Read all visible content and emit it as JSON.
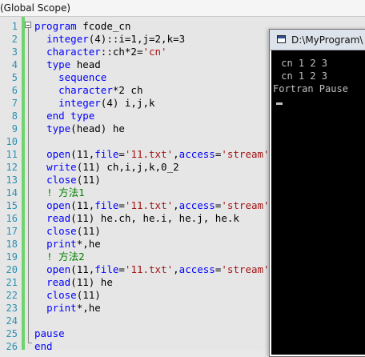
{
  "scope_bar": {
    "label": "(Global Scope)"
  },
  "editor": {
    "line_numbers": [
      "1",
      "2",
      "3",
      "4",
      "5",
      "6",
      "7",
      "8",
      "9",
      "10",
      "11",
      "12",
      "13",
      "14",
      "15",
      "16",
      "17",
      "18",
      "19",
      "20",
      "21",
      "22",
      "23",
      "24",
      "25",
      "26"
    ],
    "lines": [
      [
        {
          "t": "program",
          "k": "k"
        },
        {
          "t": " fcode_cn"
        }
      ],
      [
        {
          "t": "  "
        },
        {
          "t": "integer",
          "k": "k"
        },
        {
          "t": "(4)::i=1,j=2,k=3"
        }
      ],
      [
        {
          "t": "  "
        },
        {
          "t": "character",
          "k": "k"
        },
        {
          "t": "::ch*2="
        },
        {
          "t": "'cn'",
          "k": "s"
        }
      ],
      [
        {
          "t": "  "
        },
        {
          "t": "type",
          "k": "k"
        },
        {
          "t": " head"
        }
      ],
      [
        {
          "t": "    "
        },
        {
          "t": "sequence",
          "k": "k"
        }
      ],
      [
        {
          "t": "    "
        },
        {
          "t": "character",
          "k": "k"
        },
        {
          "t": "*2 ch"
        }
      ],
      [
        {
          "t": "    "
        },
        {
          "t": "integer",
          "k": "k"
        },
        {
          "t": "(4) i,j,k"
        }
      ],
      [
        {
          "t": "  "
        },
        {
          "t": "end type",
          "k": "k"
        }
      ],
      [
        {
          "t": "  "
        },
        {
          "t": "type",
          "k": "k"
        },
        {
          "t": "(head) he"
        }
      ],
      [
        {
          "t": ""
        }
      ],
      [
        {
          "t": "  "
        },
        {
          "t": "open",
          "k": "k"
        },
        {
          "t": "(11,"
        },
        {
          "t": "file",
          "k": "k"
        },
        {
          "t": "="
        },
        {
          "t": "'11.txt'",
          "k": "s"
        },
        {
          "t": ","
        },
        {
          "t": "access",
          "k": "k"
        },
        {
          "t": "="
        },
        {
          "t": "'stream'",
          "k": "s"
        },
        {
          "t": ")"
        }
      ],
      [
        {
          "t": "  "
        },
        {
          "t": "write",
          "k": "k"
        },
        {
          "t": "(11) ch,i,j,k,0_2"
        }
      ],
      [
        {
          "t": "  "
        },
        {
          "t": "close",
          "k": "k"
        },
        {
          "t": "(11)"
        }
      ],
      [
        {
          "t": "  "
        },
        {
          "t": "! 方法1",
          "k": "c"
        }
      ],
      [
        {
          "t": "  "
        },
        {
          "t": "open",
          "k": "k"
        },
        {
          "t": "(11,"
        },
        {
          "t": "file",
          "k": "k"
        },
        {
          "t": "="
        },
        {
          "t": "'11.txt'",
          "k": "s"
        },
        {
          "t": ","
        },
        {
          "t": "access",
          "k": "k"
        },
        {
          "t": "="
        },
        {
          "t": "'stream'",
          "k": "s"
        },
        {
          "t": ")"
        }
      ],
      [
        {
          "t": "  "
        },
        {
          "t": "read",
          "k": "k"
        },
        {
          "t": "(11) he.ch, he.i, he.j, he.k"
        }
      ],
      [
        {
          "t": "  "
        },
        {
          "t": "close",
          "k": "k"
        },
        {
          "t": "(11)"
        }
      ],
      [
        {
          "t": "  "
        },
        {
          "t": "print",
          "k": "k"
        },
        {
          "t": "*,he"
        }
      ],
      [
        {
          "t": "  "
        },
        {
          "t": "! 方法2",
          "k": "c"
        }
      ],
      [
        {
          "t": "  "
        },
        {
          "t": "open",
          "k": "k"
        },
        {
          "t": "(11,"
        },
        {
          "t": "file",
          "k": "k"
        },
        {
          "t": "="
        },
        {
          "t": "'11.txt'",
          "k": "s"
        },
        {
          "t": ","
        },
        {
          "t": "access",
          "k": "k"
        },
        {
          "t": "="
        },
        {
          "t": "'stream'",
          "k": "s"
        },
        {
          "t": ")"
        }
      ],
      [
        {
          "t": "  "
        },
        {
          "t": "read",
          "k": "k"
        },
        {
          "t": "(11) he"
        }
      ],
      [
        {
          "t": "  "
        },
        {
          "t": "close",
          "k": "k"
        },
        {
          "t": "(11)"
        }
      ],
      [
        {
          "t": "  "
        },
        {
          "t": "print",
          "k": "k"
        },
        {
          "t": "*,he"
        }
      ],
      [
        {
          "t": ""
        }
      ],
      [
        {
          "t": "pause",
          "k": "k"
        }
      ],
      [
        {
          "t": "end",
          "k": "k"
        }
      ]
    ]
  },
  "console": {
    "title": "D:\\MyProgram\\",
    "output": [
      " cn 1 2 3",
      " cn 1 2 3",
      "Fortran Pause"
    ]
  },
  "colors": {
    "keyword": "#0000ff",
    "string": "#a31515",
    "comment": "#008000",
    "line_number": "#2b91af",
    "change_bar": "#6fd46f",
    "console_bg": "#000000",
    "console_text": "#c0c0c0"
  }
}
